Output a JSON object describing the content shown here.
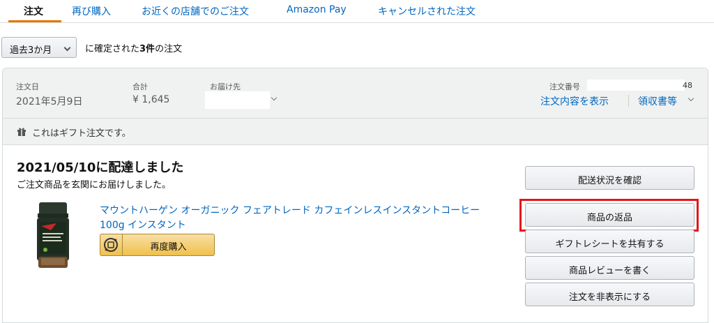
{
  "tabs": [
    {
      "label": "注文"
    },
    {
      "label": "再び購入"
    },
    {
      "label": "お近くの店舗でのご注文"
    },
    {
      "label": "Amazon Pay"
    },
    {
      "label": "キャンセルされた注文"
    }
  ],
  "filter": {
    "period_selected": "過去3か月",
    "summary_prefix": "に確定された",
    "summary_count": "3件",
    "summary_suffix": "の注文"
  },
  "order": {
    "date_label": "注文日",
    "date_value": "2021年5月9日",
    "total_label": "合計",
    "total_value": "¥ 1,645",
    "ship_to_label": "お届け先",
    "order_number_label": "注文番号",
    "order_number_suffix": "48",
    "view_details_link": "注文内容を表示",
    "receipt_link": "領収書等",
    "gift_notice": "これはギフト注文です。",
    "delivery_status": "2021/05/10に配達しました",
    "delivery_detail": "ご注文商品を玄関にお届けしました。",
    "product_title": "マウントハーゲン オーガニック フェアトレード カフェインレスインスタントコーヒー100g インスタント",
    "rebuy_label": "再度購入"
  },
  "actions": [
    {
      "label": "配送状況を確認"
    },
    {
      "label": "商品の返品"
    },
    {
      "label": "ギフトレシートを共有する"
    },
    {
      "label": "商品レビューを書く"
    },
    {
      "label": "注文を非表示にする"
    }
  ],
  "colors": {
    "link": "#0066c0",
    "tab_underline": "#e77600",
    "highlight": "#e4151c",
    "buy_button": "#f0c14b",
    "header_bg": "#f0f2f2"
  },
  "icons": {
    "gift": "gift-icon",
    "rebuy": "refresh-icon",
    "dropdown": "chevron-down-icon"
  }
}
